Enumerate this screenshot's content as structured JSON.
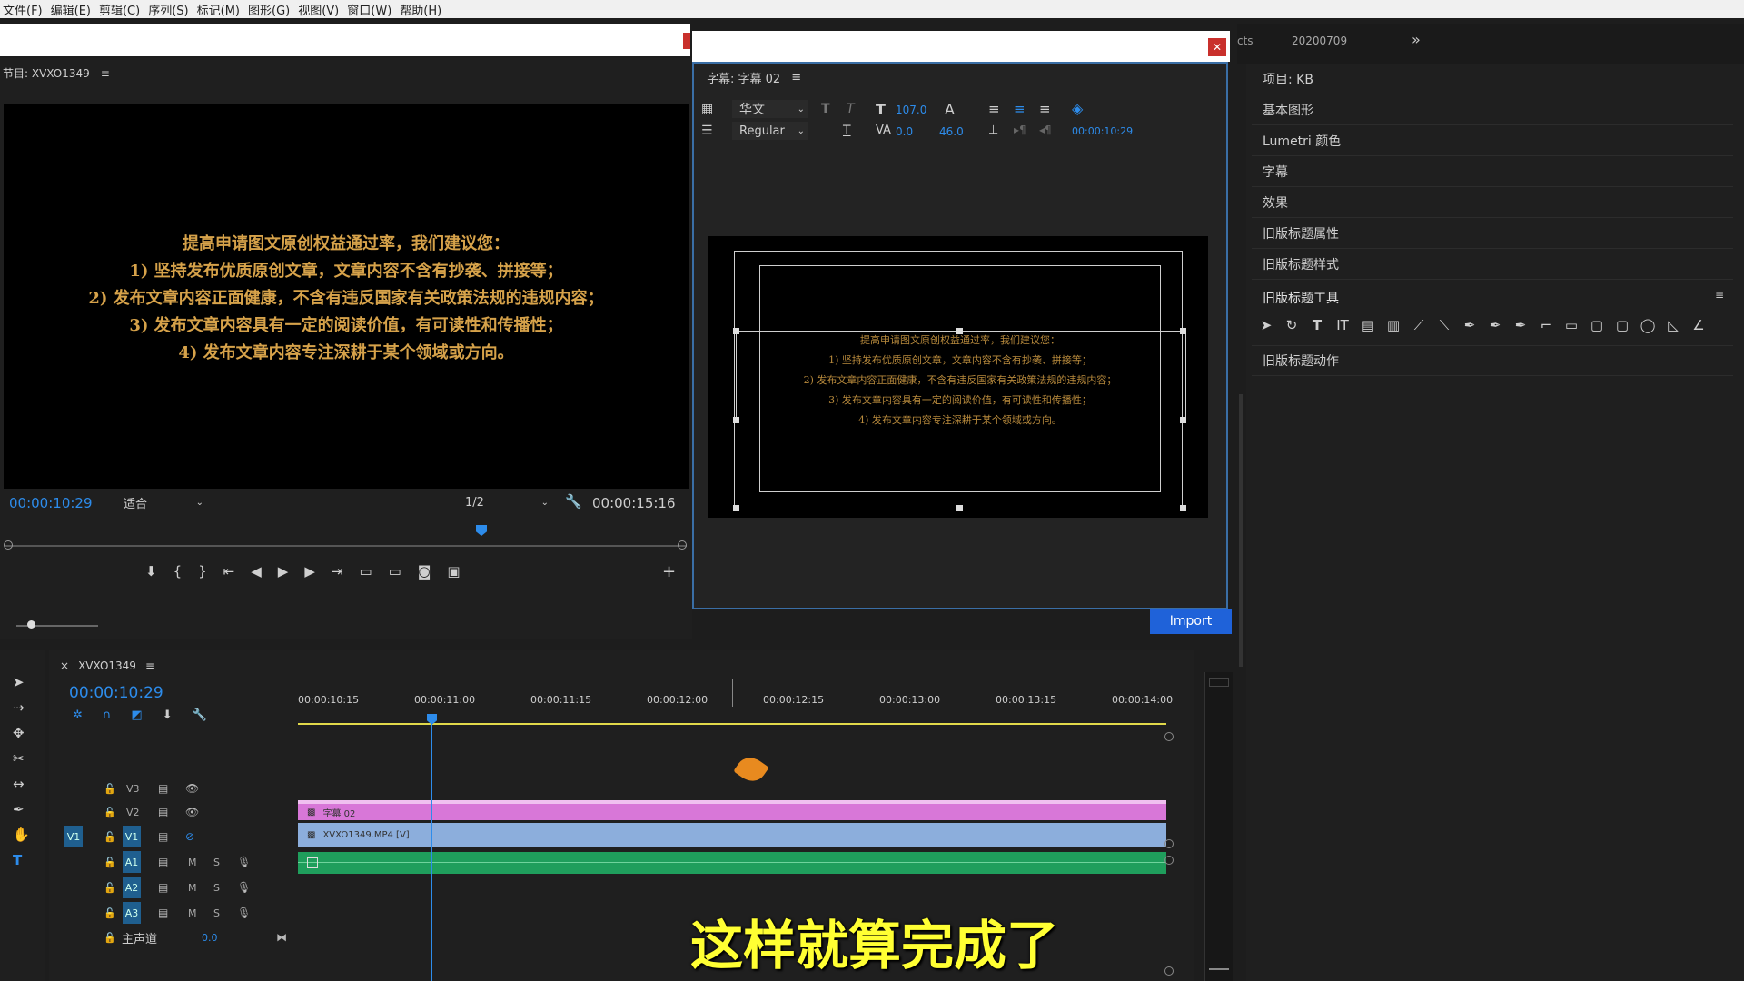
{
  "menu": [
    "文件(F)",
    "编辑(E)",
    "剪辑(C)",
    "序列(S)",
    "标记(M)",
    "图形(G)",
    "视图(V)",
    "窗口(W)",
    "帮助(H)"
  ],
  "program_monitor": {
    "title": "节目: XVXO1349",
    "subtitle_lines": [
      "提高申请图文原创权益通过率，我们建议您：",
      "1) 坚持发布优质原创文章，文章内容不含有抄袭、拼接等；",
      "2) 发布文章内容正面健康，不含有违反国家有关政策法规的违规内容；",
      "3) 发布文章内容具有一定的阅读价值，有可读性和传播性；",
      "4) 发布文章内容专注深耕于某个领域或方向。"
    ],
    "timecode": "00:00:10:29",
    "fit_label": "适合",
    "resolution": "1/2",
    "duration": "00:00:15:16"
  },
  "titler": {
    "tab_title": "字幕: 字幕 02",
    "font_family": "华文",
    "font_style": "Regular",
    "font_size": "107.0",
    "kerning": "0.0",
    "leading": "46.0",
    "timecode": "00:00:10:29",
    "import_label": "Import"
  },
  "right_panel": {
    "tab_partial": "cts",
    "tab_date": "20200709",
    "items": [
      "项目: KB",
      "基本图形",
      "Lumetri 颜色",
      "字幕",
      "效果",
      "旧版标题属性",
      "旧版标题样式"
    ],
    "tools_header": "旧版标题工具",
    "actions": "旧版标题动作"
  },
  "timeline": {
    "tab": "XVXO1349",
    "timecode": "00:00:10:29",
    "ruler": [
      "00:00:10:15",
      "00:00:11:00",
      "00:00:11:15",
      "00:00:12:00",
      "00:00:12:15",
      "00:00:13:00",
      "00:00:13:15",
      "00:00:14:00"
    ],
    "tracks": {
      "v3": "V3",
      "v2": "V2",
      "v1": "V1",
      "v1_src": "V1",
      "a1": "A1",
      "a2": "A2",
      "a3": "A3",
      "master": "主声道",
      "master_value": "0.0",
      "mute": "M",
      "solo": "S"
    },
    "clip_title": "字幕 02",
    "clip_video": "XVXO1349.MP4 [V]"
  },
  "overlay_caption": "这样就算完成了",
  "colors": {
    "accent": "#2d8ceb",
    "subtitle": "#d6a24a",
    "title_clip": "#d877d8",
    "video_clip": "#8caedc",
    "audio_clip": "#1f9e5c",
    "caption": "#ffff33"
  }
}
